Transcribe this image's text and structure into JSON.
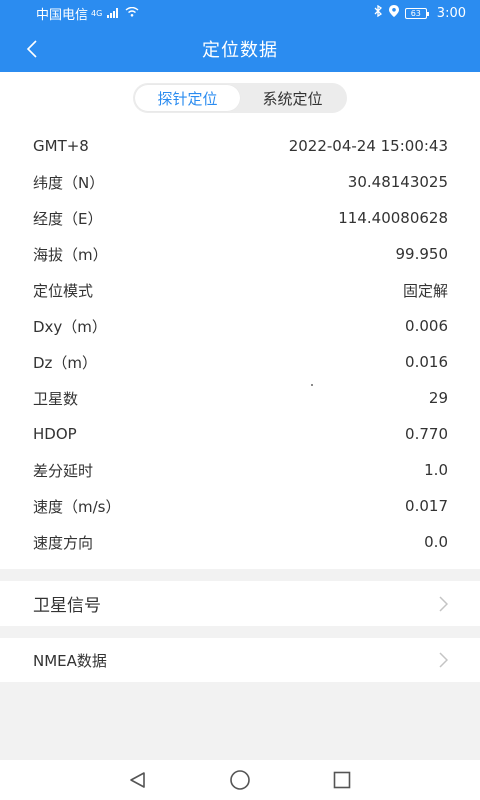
{
  "status_bar": {
    "carrier": "中国电信",
    "network": "4G",
    "battery": "63",
    "time": "3:00"
  },
  "header": {
    "title": "定位数据",
    "back_icon": "chevron-left-icon"
  },
  "segment": {
    "tabs": [
      {
        "label": "探针定位",
        "active": true
      },
      {
        "label": "系统定位",
        "active": false
      }
    ]
  },
  "rows": [
    {
      "label": "GMT+8",
      "value": "2022-04-24 15:00:43"
    },
    {
      "label": "纬度（N）",
      "value": "30.48143025"
    },
    {
      "label": "经度（E）",
      "value": "114.40080628"
    },
    {
      "label": "海拔（m）",
      "value": "99.950"
    },
    {
      "label": "定位模式",
      "value": "固定解"
    },
    {
      "label": "Dxy（m）",
      "value": "0.006"
    },
    {
      "label": "Dz（m）",
      "value": "0.016"
    },
    {
      "label": "卫星数",
      "value": "29"
    },
    {
      "label": "HDOP",
      "value": "0.770"
    },
    {
      "label": "差分延时",
      "value": "1.0"
    },
    {
      "label": "速度（m/s）",
      "value": "0.017"
    },
    {
      "label": "速度方向",
      "value": "0.0"
    }
  ],
  "links": {
    "satellite": "卫星信号",
    "nmea": "NMEA数据"
  },
  "colors": {
    "accent": "#2b8cf0",
    "divider": "#f2f2f2"
  }
}
